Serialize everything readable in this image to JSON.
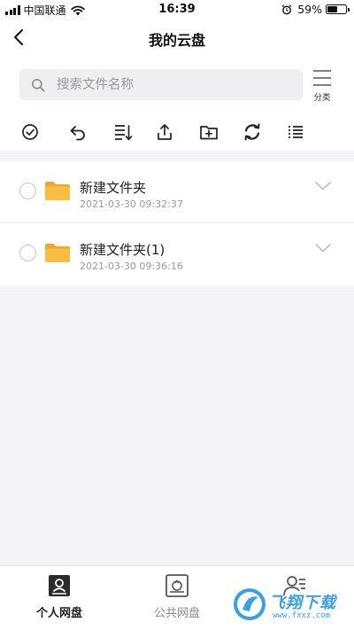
{
  "status_bar": {
    "carrier": "中国联通",
    "time": "16:39",
    "battery_percent": "59%",
    "battery_level": 0.59
  },
  "nav": {
    "title": "我的云盘",
    "back_icon": "chevron-left-icon"
  },
  "search": {
    "placeholder": "搜索文件名称",
    "value": ""
  },
  "category": {
    "label": "分类",
    "icon": "hamburger-icon"
  },
  "toolbar": {
    "icons": [
      "check-circle-icon",
      "undo-icon",
      "sort-icon",
      "upload-icon",
      "new-folder-icon",
      "refresh-icon",
      "list-icon"
    ]
  },
  "files": [
    {
      "name": "新建文件夹",
      "date": "2021-03-30 09:32:37",
      "icon": "folder-icon"
    },
    {
      "name": "新建文件夹(1)",
      "date": "2021-03-30 09:36:16",
      "icon": "folder-icon"
    }
  ],
  "tabs": [
    {
      "label": "个人网盘",
      "icon": "personal-disk-icon",
      "active": true
    },
    {
      "label": "公共网盘",
      "icon": "public-disk-icon",
      "active": false
    },
    {
      "label": "",
      "icon": "user-list-icon",
      "active": false
    }
  ],
  "watermark": {
    "text": "飞翔下载",
    "url": "www.fxxz.com"
  },
  "colors": {
    "folder": "#f6b93b",
    "accent_watermark": "#3aa0e6",
    "background": "#f4f4f6"
  }
}
